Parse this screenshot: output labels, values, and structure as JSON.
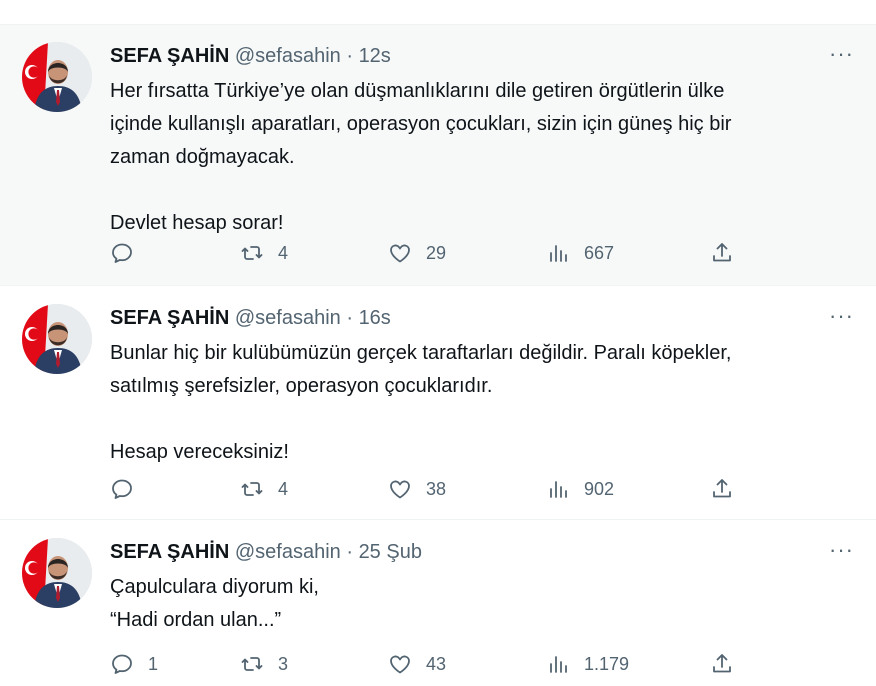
{
  "tweets": [
    {
      "author_name": "SEFA ŞAHİN",
      "handle": "@sefasahin",
      "separator": "·",
      "time": "12s",
      "more_label": "···",
      "lines": [
        "Her fırsatta Türkiye’ye olan düşmanlıklarını dile getiren örgütlerin ülke",
        "içinde kullanışlı aparatları, operasyon çocukları, sizin için güneş hiç bir",
        "zaman doğmayacak.",
        "",
        "Devlet hesap sorar!"
      ],
      "replies": "",
      "retweets": "4",
      "likes": "29",
      "views": "667"
    },
    {
      "author_name": "SEFA ŞAHİN",
      "handle": "@sefasahin",
      "separator": "·",
      "time": "16s",
      "more_label": "···",
      "lines": [
        "Bunlar hiç bir kulübümüzün gerçek taraftarları değildir. Paralı köpekler,",
        "satılmış şerefsizler, operasyon çocuklarıdır.",
        "",
        "Hesap vereceksiniz!"
      ],
      "replies": "",
      "retweets": "4",
      "likes": "38",
      "views": "902"
    },
    {
      "author_name": "SEFA ŞAHİN",
      "handle": "@sefasahin",
      "separator": "·",
      "time": "25 Şub",
      "more_label": "···",
      "lines": [
        "Çapulculara diyorum ki,",
        "“Hadi ordan ulan...”"
      ],
      "replies": "1",
      "retweets": "3",
      "likes": "43",
      "views": "1.179"
    }
  ],
  "icons": {
    "reply": "reply-icon",
    "retweet": "retweet-icon",
    "like": "heart-icon",
    "views": "views-icon",
    "share": "share-icon",
    "more": "more-icon"
  },
  "colors": {
    "text": "#0f1419",
    "secondary": "#536471",
    "highlight_bg": "#f7f9f9",
    "border": "#eff3f4",
    "flag_red": "#e30a17"
  }
}
